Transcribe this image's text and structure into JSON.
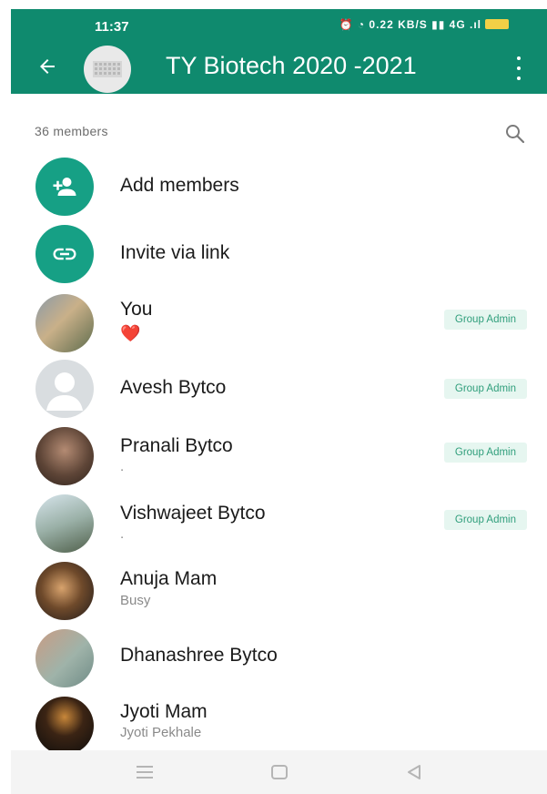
{
  "status_bar": {
    "time": "11:37",
    "icons_text": "⏰ ◔ 0.22 KB/S ▮▮ 4G .ıl"
  },
  "header": {
    "title": "TY Biotech 2020 -2021"
  },
  "members": {
    "count_label": "36 members"
  },
  "actions": [
    {
      "label": "Add members",
      "icon": "add-person-icon"
    },
    {
      "label": "Invite via link",
      "icon": "link-icon"
    }
  ],
  "list": [
    {
      "name": "You",
      "status": "❤️",
      "badge": "Group Admin"
    },
    {
      "name": "Avesh Bytco",
      "status": "",
      "badge": "Group Admin"
    },
    {
      "name": "Pranali Bytco",
      "status": ".",
      "badge": "Group Admin"
    },
    {
      "name": "Vishwajeet Bytco",
      "status": ".",
      "badge": "Group Admin"
    },
    {
      "name": "Anuja Mam",
      "status": "Busy",
      "badge": ""
    },
    {
      "name": "Dhanashree Bytco",
      "status": "",
      "badge": ""
    },
    {
      "name": "Jyoti Mam",
      "status": "Jyoti Pekhale",
      "badge": ""
    }
  ],
  "colors": {
    "header": "#0f8a6e",
    "accent": "#16a085",
    "badge_bg": "#e6f6f0",
    "badge_text": "#2f9e7b"
  }
}
